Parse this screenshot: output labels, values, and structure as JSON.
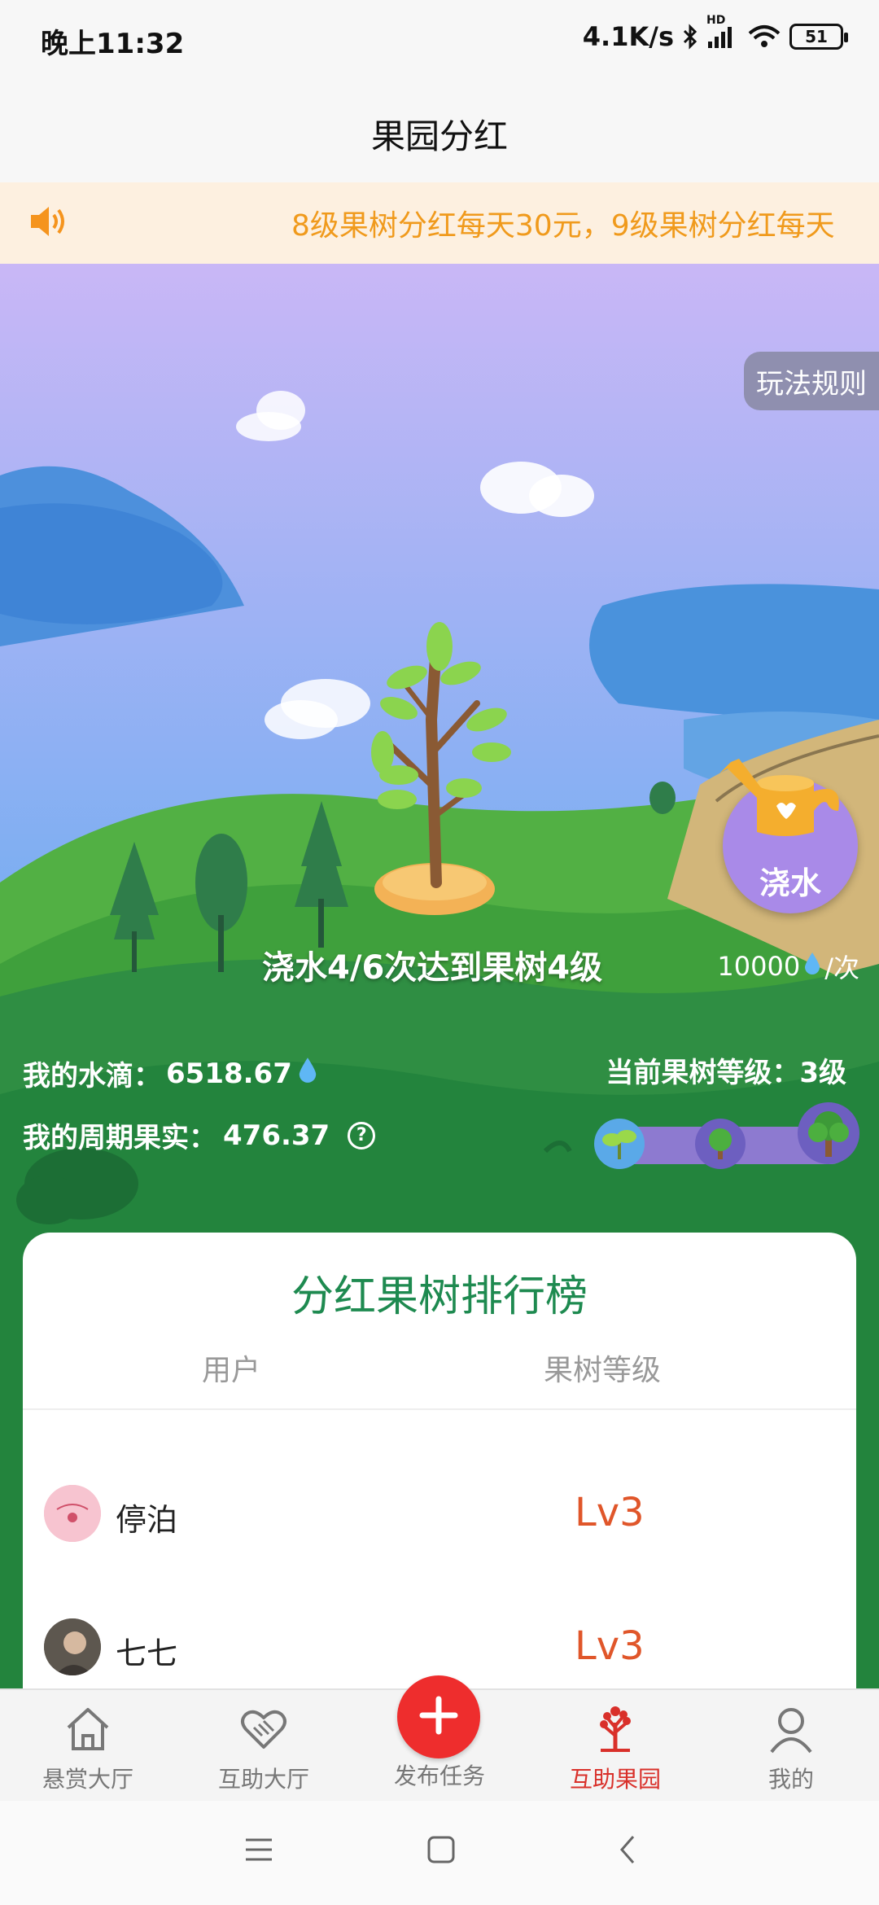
{
  "status_bar": {
    "time": "晚上11:32",
    "net_speed": "4.1K/s",
    "hd_tag": "HD",
    "battery": "51"
  },
  "header": {
    "title": "果园分红"
  },
  "notice": {
    "text": "8级果树分红每天30元，9级果树分红每天"
  },
  "orchard": {
    "rules_label": "玩法规则",
    "water_button_label": "浇水",
    "progress_text": "浇水4/6次达到果树4级",
    "cost_amount": "10000",
    "cost_unit": "/次",
    "my_drops_label": "我的水滴：",
    "my_drops_value": "6518.67",
    "my_fruit_label": "我的周期果实：",
    "my_fruit_value": "476.37",
    "current_level_label": "当前果树等级：",
    "current_level_value": "3级",
    "help_icon": "?"
  },
  "ranking": {
    "title": "分红果树排行榜",
    "col_user": "用户",
    "col_level": "果树等级",
    "rows": [
      {
        "name": "停泊",
        "level": "Lv3"
      },
      {
        "name": "七七",
        "level": "Lv3"
      }
    ]
  },
  "tabbar": {
    "items": [
      {
        "label": "悬赏大厅",
        "icon": "home-icon"
      },
      {
        "label": "互助大厅",
        "icon": "handshake-icon"
      },
      {
        "label": "发布任务",
        "icon": "plus-icon"
      },
      {
        "label": "互助果园",
        "icon": "tree-icon"
      },
      {
        "label": "我的",
        "icon": "user-icon"
      }
    ],
    "active_color": "#d9302a"
  },
  "colors": {
    "accent_green": "#1e8a50",
    "level_red": "#e0562a",
    "notice_orange": "#f09a1c",
    "publish_red": "#ee2d2d"
  }
}
